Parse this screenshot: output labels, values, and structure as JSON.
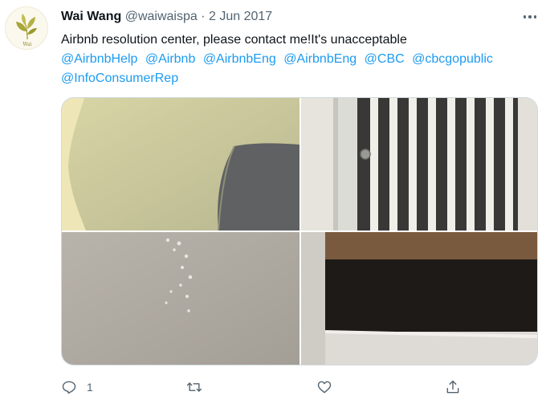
{
  "tweet": {
    "author": {
      "display_name": "Wai Wang",
      "handle": "@waiwaispa",
      "avatar_icon": "leaf-logo-icon",
      "avatar_text": "Wai"
    },
    "separator": "·",
    "date": "2 Jun 2017",
    "text": "Airbnb resolution center, please contact me!It's unacceptable",
    "mentions": [
      "@AirbnbHelp",
      "@Airbnb",
      "@AirbnbEng",
      "@AirbnbEng",
      "@CBC",
      "@cbcgopublic",
      "@InfoConsumerRep"
    ],
    "media": [
      {
        "icon": "photo-wall-stain-icon"
      },
      {
        "icon": "photo-vent-grille-icon"
      },
      {
        "icon": "photo-wall-drips-icon"
      },
      {
        "icon": "photo-vent-opening-icon"
      }
    ],
    "actions": {
      "reply": {
        "icon": "reply-icon",
        "count": "1"
      },
      "retweet": {
        "icon": "retweet-icon",
        "count": ""
      },
      "like": {
        "icon": "heart-icon",
        "count": ""
      },
      "share": {
        "icon": "share-icon",
        "count": ""
      }
    },
    "more_icon": "more-icon",
    "colors": {
      "link": "#1d9bf0",
      "secondary_text": "#536471",
      "primary_text": "#0f1419"
    }
  }
}
